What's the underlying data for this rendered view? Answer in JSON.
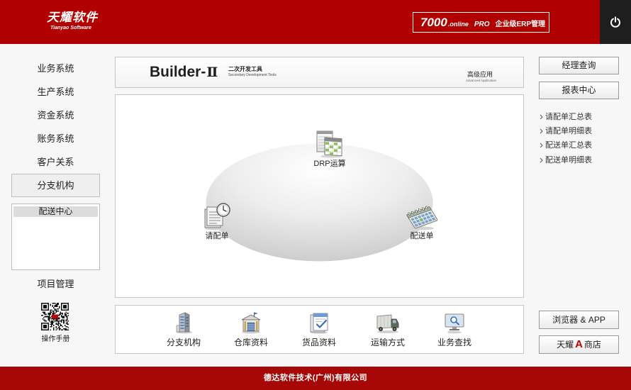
{
  "colors": {
    "header_red": "#b10000",
    "footer_red": "#a60808",
    "power_bg": "#1e1e1e",
    "store_accent": "#c00000"
  },
  "header": {
    "logo_cn": "天耀软件",
    "logo_en": "Tianyao Software",
    "product_number": "7000",
    "product_suffix": ".online",
    "product_edition": "PRO",
    "product_desc": "企业级ERP管理",
    "power_icon": "power-icon"
  },
  "sidebar": {
    "items": [
      {
        "label": "业务系统"
      },
      {
        "label": "生产系统"
      },
      {
        "label": "资金系统"
      },
      {
        "label": "账务系统"
      },
      {
        "label": "客户关系"
      },
      {
        "label": "分支机构",
        "selected": true
      }
    ],
    "sub_items": [
      {
        "label": "配送中心",
        "selected": true
      }
    ],
    "project": "项目管理",
    "manual": "操作手册",
    "manual_icon": "qr-code-icon"
  },
  "banner": {
    "title": "Builder-",
    "title_numeral": "Ⅱ",
    "subtitle_cn": "二次开发工具",
    "subtitle_en": "Secondary Development Tools",
    "tag_cn": "高级应用",
    "tag_en": "Advanced Application"
  },
  "flow": {
    "nodes": [
      {
        "label": "DRP运算",
        "icon": "spreadsheet-icon"
      },
      {
        "label": "请配单",
        "icon": "document-clock-icon"
      },
      {
        "label": "配送单",
        "icon": "calendar-icon"
      }
    ]
  },
  "toolbar": {
    "items": [
      {
        "label": "分支机构",
        "icon": "building-icon"
      },
      {
        "label": "仓库资料",
        "icon": "warehouse-icon"
      },
      {
        "label": "货品资料",
        "icon": "clipboard-check-icon"
      },
      {
        "label": "运输方式",
        "icon": "truck-icon"
      },
      {
        "label": "业务查找",
        "icon": "monitor-search-icon"
      }
    ]
  },
  "right_panel": {
    "buttons": [
      {
        "label": "经理查询"
      },
      {
        "label": "报表中心"
      }
    ],
    "links": [
      {
        "label": "请配单汇总表"
      },
      {
        "label": "请配单明细表"
      },
      {
        "label": "配送单汇总表"
      },
      {
        "label": "配送单明细表"
      }
    ],
    "browser_app": "浏览器 & APP",
    "store_prefix": "天耀",
    "store_mark": "A",
    "store_suffix": "商店"
  },
  "footer": {
    "company": "德达软件技术(广州)有限公司"
  }
}
